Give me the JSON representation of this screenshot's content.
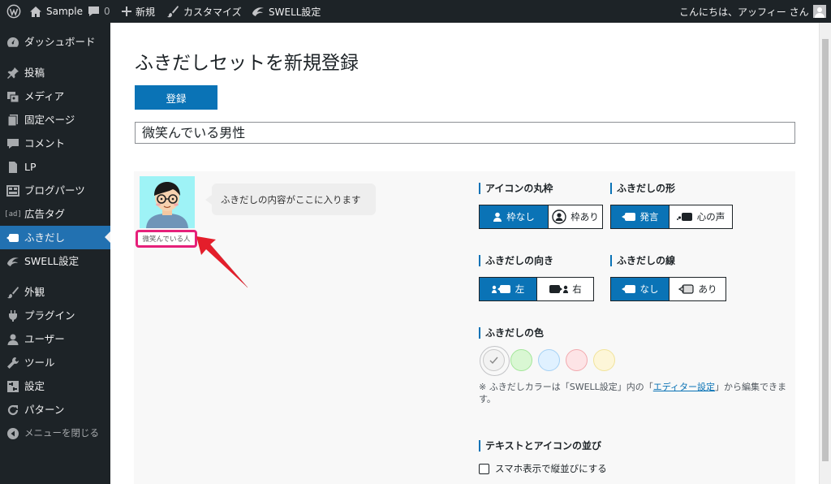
{
  "adminbar": {
    "site_name": "Sample",
    "comments_count": "0",
    "new_label": "新規",
    "customize_label": "カスタマイズ",
    "swell_label": "SWELL設定",
    "greeting": "こんにちは、アッフィー さん"
  },
  "sidebar": {
    "items": [
      {
        "label": "ダッシュボード",
        "icon": "gauge-icon"
      },
      {
        "label": "投稿",
        "icon": "pin-icon"
      },
      {
        "label": "メディア",
        "icon": "media-icon"
      },
      {
        "label": "固定ページ",
        "icon": "page-icon"
      },
      {
        "label": "コメント",
        "icon": "comment-icon"
      },
      {
        "label": "LP",
        "icon": "document-icon"
      },
      {
        "label": "ブログパーツ",
        "icon": "grid-icon"
      },
      {
        "label": "広告タグ",
        "icon": "ad-icon"
      },
      {
        "label": "ふきだし",
        "icon": "balloon-icon",
        "active": true
      },
      {
        "label": "SWELL設定",
        "icon": "swell-icon"
      },
      {
        "label": "外観",
        "icon": "brush-icon"
      },
      {
        "label": "プラグイン",
        "icon": "plug-icon"
      },
      {
        "label": "ユーザー",
        "icon": "user-icon"
      },
      {
        "label": "ツール",
        "icon": "wrench-icon"
      },
      {
        "label": "設定",
        "icon": "settings-icon"
      },
      {
        "label": "パターン",
        "icon": "pattern-icon"
      },
      {
        "label": "メニューを閉じる",
        "icon": "collapse-icon"
      }
    ]
  },
  "main": {
    "page_title": "ふきだしセットを新規登録",
    "register_button": "登録",
    "title_value": "微笑んでいる男性",
    "preview": {
      "caption": "微笑んでいる人",
      "bubble_text": "ふきだしの内容がここに入ります"
    },
    "settings": {
      "icon_frame": {
        "title": "アイコンの丸枠",
        "options": [
          "枠なし",
          "枠あり"
        ],
        "selected": 0
      },
      "balloon_shape": {
        "title": "ふきだしの形",
        "options": [
          "発言",
          "心の声"
        ],
        "selected": 0
      },
      "balloon_direction": {
        "title": "ふきだしの向き",
        "options": [
          "左",
          "右"
        ],
        "selected": 0
      },
      "balloon_border": {
        "title": "ふきだしの線",
        "options": [
          "なし",
          "あり"
        ],
        "selected": 0
      },
      "balloon_color": {
        "title": "ふきだしの色",
        "swatches": [
          {
            "name": "gray",
            "fill": "#f2f2f2",
            "border": "#c9c9c9"
          },
          {
            "name": "green",
            "fill": "#d9f7d3",
            "border": "#a3e69a"
          },
          {
            "name": "blue",
            "fill": "#e0f1ff",
            "border": "#a4d1f5"
          },
          {
            "name": "red",
            "fill": "#fde4e6",
            "border": "#f2a9ae"
          },
          {
            "name": "yellow",
            "fill": "#fdf6d8",
            "border": "#f1e39a"
          }
        ],
        "selected": 0
      },
      "color_note_prefix": "※ ふきだしカラーは「SWELL設定」内の「",
      "color_note_link": "エディター設定",
      "color_note_suffix": "」から編集できます。",
      "layout": {
        "title": "テキストとアイコンの並び",
        "checkbox_label": "スマホ表示で縦並びにする"
      }
    }
  },
  "colors": {
    "accent": "#0a73b6",
    "highlight": "#e6207a",
    "sidebar_bg": "#1d2327"
  }
}
